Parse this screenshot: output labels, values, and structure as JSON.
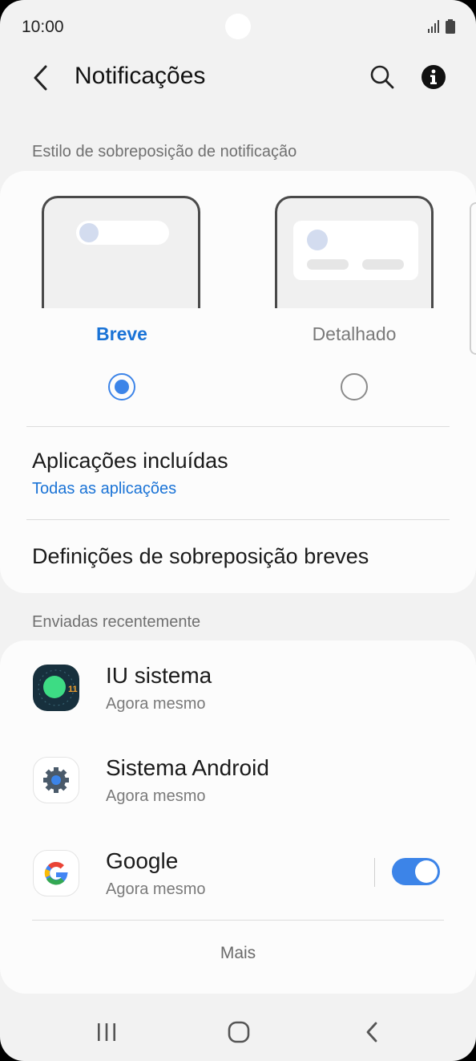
{
  "status_bar": {
    "time": "10:00",
    "icons": [
      "signal-icon",
      "battery-icon"
    ]
  },
  "header": {
    "title": "Notificações",
    "icons": [
      "back-arrow-icon",
      "search-icon",
      "info-icon"
    ]
  },
  "overlay_style": {
    "section_title": "Estilo de sobreposição de notificação",
    "options": [
      {
        "label": "Breve",
        "selected": true
      },
      {
        "label": "Detalhado",
        "selected": false
      }
    ],
    "included_apps": {
      "title": "Aplicações incluídas",
      "value": "Todas as aplicações"
    },
    "brief_settings": {
      "title": "Definições de sobreposição breves"
    }
  },
  "recent": {
    "section_title": "Enviadas recentemente",
    "apps": [
      {
        "name": "IU sistema",
        "time": "Agora mesmo",
        "icon": "system-ui-icon"
      },
      {
        "name": "Sistema Android",
        "time": "Agora mesmo",
        "icon": "android-system-gear-icon"
      },
      {
        "name": "Google",
        "time": "Agora mesmo",
        "icon": "google-g-icon",
        "toggle_on": true
      }
    ],
    "more_label": "Mais"
  },
  "nav_bar": {
    "icons": [
      "recents-icon",
      "home-icon",
      "back-icon"
    ]
  },
  "colors": {
    "accent": "#3c84e8",
    "link": "#1a73d6",
    "background": "#f2f2f2",
    "card": "#fcfcfc"
  }
}
